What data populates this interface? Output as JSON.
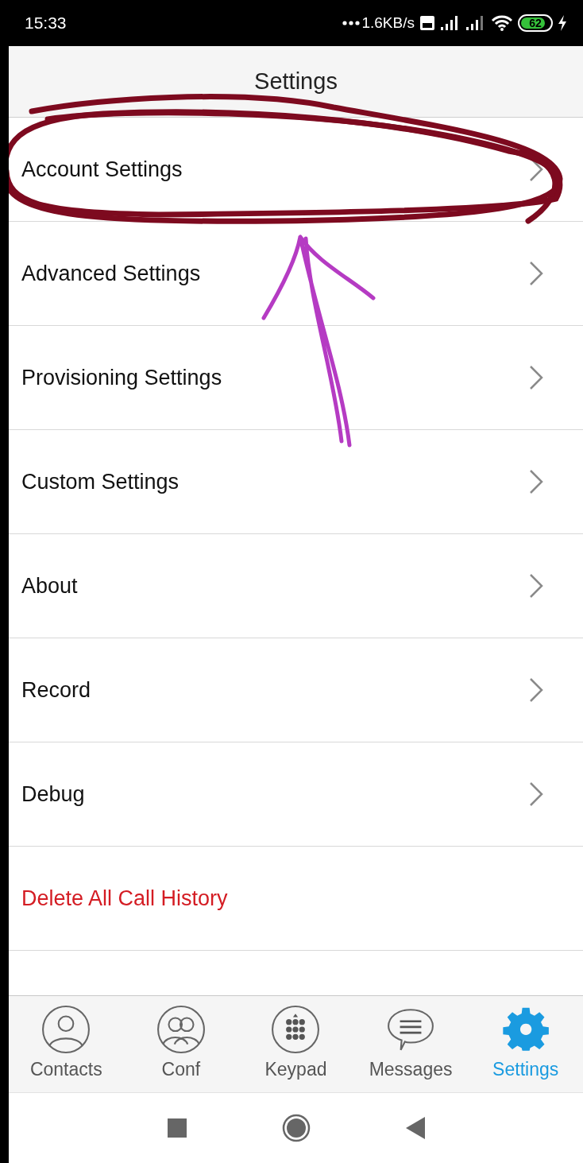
{
  "status_bar": {
    "time": "15:33",
    "speed": "1.6KB/s",
    "battery": "62"
  },
  "header": {
    "title": "Settings"
  },
  "items": [
    {
      "label": "Account Settings",
      "kind": "link"
    },
    {
      "label": "Advanced Settings",
      "kind": "link"
    },
    {
      "label": "Provisioning Settings",
      "kind": "link"
    },
    {
      "label": "Custom Settings",
      "kind": "link"
    },
    {
      "label": "About",
      "kind": "link"
    },
    {
      "label": "Record",
      "kind": "link"
    },
    {
      "label": "Debug",
      "kind": "link"
    },
    {
      "label": "Delete All Call History",
      "kind": "danger"
    },
    {
      "kind": "cut"
    }
  ],
  "tabs": [
    {
      "label": "Contacts",
      "kind": "person",
      "selected": false
    },
    {
      "label": "Conf",
      "kind": "group",
      "selected": false
    },
    {
      "label": "Keypad",
      "kind": "keypad",
      "selected": false
    },
    {
      "label": "Messages",
      "kind": "chat",
      "selected": false
    },
    {
      "label": "Settings",
      "kind": "gear",
      "selected": true
    }
  ],
  "annotations": [
    {
      "kind": "circle",
      "color": "#7d0a1f"
    },
    {
      "kind": "arrow",
      "color": "#b53bc3"
    }
  ]
}
